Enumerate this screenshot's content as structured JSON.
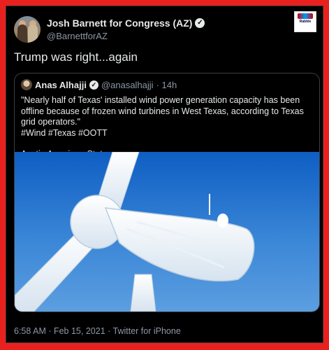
{
  "tweet": {
    "author": {
      "display_name": "Josh Barnett for Congress (AZ)",
      "handle": "@BarnettforAZ",
      "verified": true
    },
    "text": "Trump was right...again",
    "brand_logo_text": "Rabble",
    "quoted": {
      "author_name": "Anas Alhajji",
      "author_handle": "@anasalhajji",
      "time": "· 14h",
      "verified": true,
      "body": "\"Nearly half of Texas' installed wind power generation capacity has been offline because of frozen wind turbines in West Texas, according to Texas grid operators.\"\n#Wind #Texas #OOTT",
      "source": "Austin American-Statesman",
      "image": "frozen-wind-turbine-photo"
    },
    "timestamp": "6:58 AM · Feb 15, 2021 · Twitter for iPhone"
  },
  "colors": {
    "border_red": "#e8211f",
    "background": "#000000",
    "text_primary": "#e7e9ea",
    "text_secondary": "#8b98a5",
    "sky_blue": "#2f7dd3"
  },
  "icons": {
    "verified": "verified-badge-icon"
  }
}
